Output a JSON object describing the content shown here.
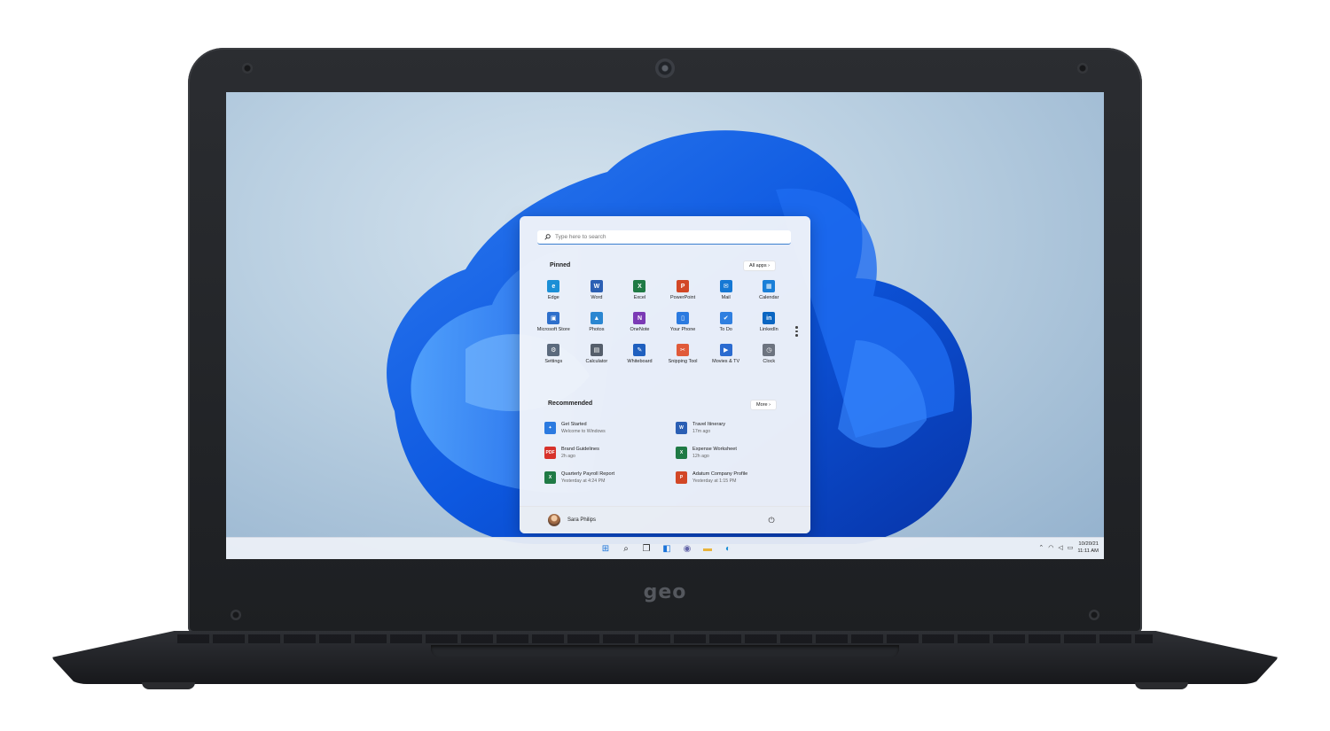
{
  "device": {
    "brand": "geo"
  },
  "start_menu": {
    "search_placeholder": "Type here to search",
    "pinned_title": "Pinned",
    "all_apps_label": "All apps",
    "all_apps_arrow": "›",
    "pinned": [
      {
        "label": "Edge",
        "icon": "edge-icon",
        "color": "#1b8fd6",
        "glyph": "e"
      },
      {
        "label": "Word",
        "icon": "word-icon",
        "color": "#2b5fb4",
        "glyph": "W"
      },
      {
        "label": "Excel",
        "icon": "excel-icon",
        "color": "#1f7a45",
        "glyph": "X"
      },
      {
        "label": "PowerPoint",
        "icon": "powerpoint-icon",
        "color": "#d24726",
        "glyph": "P"
      },
      {
        "label": "Mail",
        "icon": "mail-icon",
        "color": "#1578d4",
        "glyph": "✉"
      },
      {
        "label": "Calendar",
        "icon": "calendar-icon",
        "color": "#1a7fd8",
        "glyph": "▦"
      },
      {
        "label": "Microsoft Store",
        "icon": "store-icon",
        "color": "#2d6fcb",
        "glyph": "▣"
      },
      {
        "label": "Photos",
        "icon": "photos-icon",
        "color": "#2a86d1",
        "glyph": "▲"
      },
      {
        "label": "OneNote",
        "icon": "onenote-icon",
        "color": "#7b3ab5",
        "glyph": "N"
      },
      {
        "label": "Your Phone",
        "icon": "phone-icon",
        "color": "#2b7ae0",
        "glyph": "▯"
      },
      {
        "label": "To Do",
        "icon": "todo-icon",
        "color": "#2f7fe0",
        "glyph": "✔"
      },
      {
        "label": "LinkedIn",
        "icon": "linkedin-icon",
        "color": "#0a66c2",
        "glyph": "in"
      },
      {
        "label": "Settings",
        "icon": "settings-icon",
        "color": "#5b6a7d",
        "glyph": "⚙"
      },
      {
        "label": "Calculator",
        "icon": "calculator-icon",
        "color": "#555e6b",
        "glyph": "▤"
      },
      {
        "label": "Whiteboard",
        "icon": "whiteboard-icon",
        "color": "#1f5fbf",
        "glyph": "✎"
      },
      {
        "label": "Snipping Tool",
        "icon": "snipping-tool-icon",
        "color": "#e05a3a",
        "glyph": "✂"
      },
      {
        "label": "Movies & TV",
        "icon": "movies-icon",
        "color": "#2a6bd0",
        "glyph": "▶"
      },
      {
        "label": "Clock",
        "icon": "clock-icon",
        "color": "#6d7480",
        "glyph": "◷"
      }
    ],
    "recommended_title": "Recommended",
    "more_label": "More",
    "more_arrow": "›",
    "recommended": [
      {
        "name": "Get Started",
        "time": "Welcome to Windows",
        "icon": "get-started-icon",
        "color": "#2b7ae0",
        "glyph": "✦"
      },
      {
        "name": "Travel Itinerary",
        "time": "17m ago",
        "icon": "word-doc-icon",
        "color": "#2b5fb4",
        "glyph": "W"
      },
      {
        "name": "Brand Guidelines",
        "time": "2h ago",
        "icon": "pdf-icon",
        "color": "#d7322b",
        "glyph": "PDF"
      },
      {
        "name": "Expense Worksheet",
        "time": "12h ago",
        "icon": "excel-doc-icon",
        "color": "#1f7a45",
        "glyph": "X"
      },
      {
        "name": "Quarterly Payroll Report",
        "time": "Yesterday at 4:24 PM",
        "icon": "excel-doc-icon",
        "color": "#1f7a45",
        "glyph": "X"
      },
      {
        "name": "Adatum Company Profile",
        "time": "Yesterday at 1:15 PM",
        "icon": "powerpoint-doc-icon",
        "color": "#d24726",
        "glyph": "P"
      }
    ],
    "user_name": "Sara Philips",
    "power_glyph": "⏻"
  },
  "taskbar": {
    "icons": [
      {
        "name": "start-button",
        "icon": "windows-icon",
        "glyph": "⊞",
        "color": "#1a73d9"
      },
      {
        "name": "search-button",
        "icon": "search-icon",
        "glyph": "⌕",
        "color": "#222222"
      },
      {
        "name": "task-view-button",
        "icon": "task-view-icon",
        "glyph": "❐",
        "color": "#222222"
      },
      {
        "name": "widgets-button",
        "icon": "widgets-icon",
        "glyph": "◧",
        "color": "#1a73d9"
      },
      {
        "name": "teams-chat-button",
        "icon": "chat-icon",
        "glyph": "◉",
        "color": "#6264a7"
      },
      {
        "name": "file-explorer-button",
        "icon": "folder-icon",
        "glyph": "▬",
        "color": "#e8b33a"
      },
      {
        "name": "edge-button",
        "icon": "edge-icon",
        "glyph": "◐",
        "color": "#1b8fd6"
      }
    ],
    "tray": {
      "chevron": "⌃",
      "wifi": "◠",
      "volume": "◁",
      "battery": "▭",
      "date": "10/20/21",
      "time": "11:11 AM"
    }
  }
}
